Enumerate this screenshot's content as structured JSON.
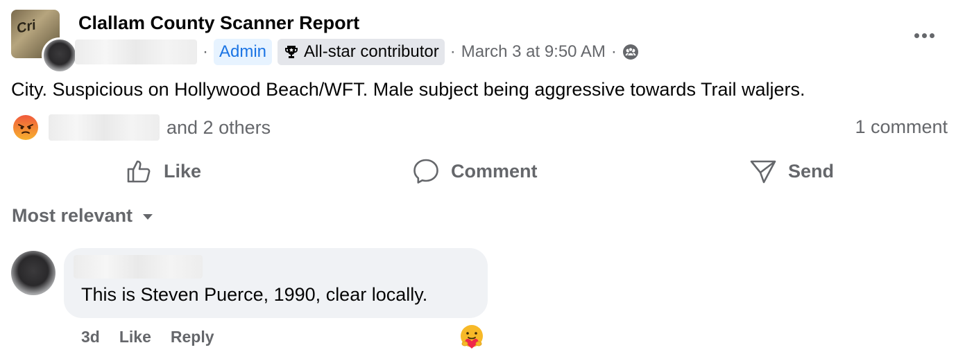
{
  "post": {
    "group_name": "Clallam County Scanner Report",
    "separator": "·",
    "badges": {
      "admin": "Admin",
      "all_star": "All-star contributor"
    },
    "timestamp": "March 3 at 9:50 AM",
    "text": "City. Suspicious on Hollywood Beach/WFT. Male subject being aggressive towards Trail waljers.",
    "reactions": {
      "icon": "angry-icon",
      "others_text": "and 2 others",
      "comment_count": "1 comment"
    },
    "actions": {
      "like": "Like",
      "comment": "Comment",
      "send": "Send"
    }
  },
  "comments_section": {
    "sort_label": "Most relevant",
    "comments": [
      {
        "text": "This is Steven Puerce, 1990, clear locally.",
        "age": "3d",
        "like_label": "Like",
        "reply_label": "Reply",
        "reaction_icon": "care-hug-icon"
      }
    ]
  },
  "colors": {
    "admin_blue": "#1b74e4",
    "admin_bg": "#e7f3ff",
    "secondary_text": "#65676b",
    "bubble_bg": "#f0f2f5"
  }
}
